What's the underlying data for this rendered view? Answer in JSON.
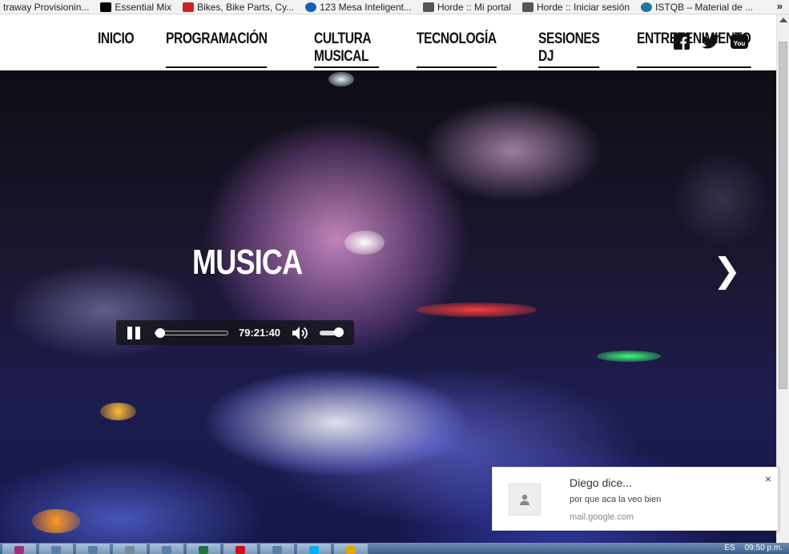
{
  "bookmarks": [
    {
      "label": "traway Provisionin...",
      "icon": "page-icon",
      "color": "#666666"
    },
    {
      "label": "Essential Mix",
      "icon": "bbc-icon",
      "color": "#000000"
    },
    {
      "label": "Bikes, Bike Parts, Cy...",
      "icon": "bike-icon",
      "color": "#cc2222"
    },
    {
      "label": "123 Mesa Inteligent...",
      "icon": "hp-icon",
      "color": "#1a5fb4"
    },
    {
      "label": "Horde :: Mi portal",
      "icon": "horde-icon",
      "color": "#555555"
    },
    {
      "label": "Horde :: Iniciar sesión",
      "icon": "horde-icon",
      "color": "#555555"
    },
    {
      "label": "ISTQB – Material de ...",
      "icon": "wordpress-icon",
      "color": "#21759b"
    }
  ],
  "bookmarks_overflow": "»",
  "nav": {
    "items": [
      {
        "label": "INICIO",
        "underlined": false
      },
      {
        "label": "PROGRAMACIÓN",
        "underlined": true
      },
      {
        "label": "CULTURA MUSICAL",
        "underlined": true
      },
      {
        "label": "TECNOLOGÍA",
        "underlined": true
      },
      {
        "label": "SESIONES DJ",
        "underlined": true
      },
      {
        "label": "ENTRETENIMIENTO",
        "underlined": true
      }
    ],
    "social": [
      "facebook-icon",
      "twitter-icon",
      "youtube-icon"
    ]
  },
  "hero": {
    "title": "MUSICA",
    "next_arrow": "❯"
  },
  "player": {
    "state": "playing",
    "time": "79:21:40",
    "progress_fraction": 0.02,
    "volume_fraction": 0.8
  },
  "notification": {
    "title": "Diego dice...",
    "message": "por que aca la veo bien",
    "source": "mail.google.com",
    "close": "×"
  },
  "taskbar": {
    "apps": [
      {
        "icon": "onenote-icon",
        "color": "#a0307e"
      },
      {
        "icon": "app-icon",
        "color": "#5a7fa8"
      },
      {
        "icon": "app-icon",
        "color": "#5a7fa8"
      },
      {
        "icon": "app-icon",
        "color": "#7a8a9a"
      },
      {
        "icon": "app-icon",
        "color": "#5a7fa8"
      },
      {
        "icon": "excel-icon",
        "color": "#217346"
      },
      {
        "icon": "acrobat-icon",
        "color": "#c8101e"
      },
      {
        "icon": "app-icon",
        "color": "#5a7fa8"
      },
      {
        "icon": "skype-icon",
        "color": "#00aff0"
      },
      {
        "icon": "outlook-icon",
        "color": "#e0a800"
      }
    ],
    "language": "ES",
    "clock": "09:50 p.m."
  }
}
